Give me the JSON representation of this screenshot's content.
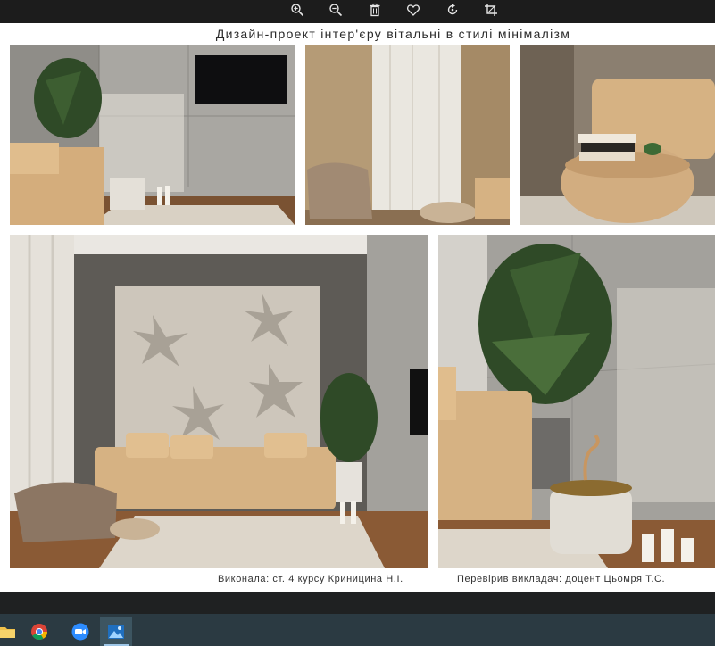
{
  "toolbar": {
    "buttons": [
      {
        "name": "zoom-in-icon"
      },
      {
        "name": "zoom-out-icon"
      },
      {
        "name": "trash-icon"
      },
      {
        "name": "heart-icon"
      },
      {
        "name": "rotate-icon"
      },
      {
        "name": "crop-icon"
      }
    ]
  },
  "document": {
    "title": "Дизайн-проект інтер'єру вітальні в стилі мінімалізм",
    "credits_author": "Виконала: ст. 4 курсу Криницина Н.І.",
    "credits_reviewer": "Перевірив викладач: доцент Цьомря Т.С."
  },
  "colors": {
    "sofa": "#d6b283",
    "concrete": "#a3a19c",
    "wall_dark": "#5e5b56",
    "floor_wood": "#8a5a35",
    "rug": "#ddd6ca",
    "plant": "#2f4a27",
    "panel": "#cdc6bb",
    "curtain": "#b59b76"
  },
  "taskbar": {
    "apps": [
      "folder-icon",
      "chrome-icon",
      "zoom-icon",
      "photos-icon"
    ]
  }
}
